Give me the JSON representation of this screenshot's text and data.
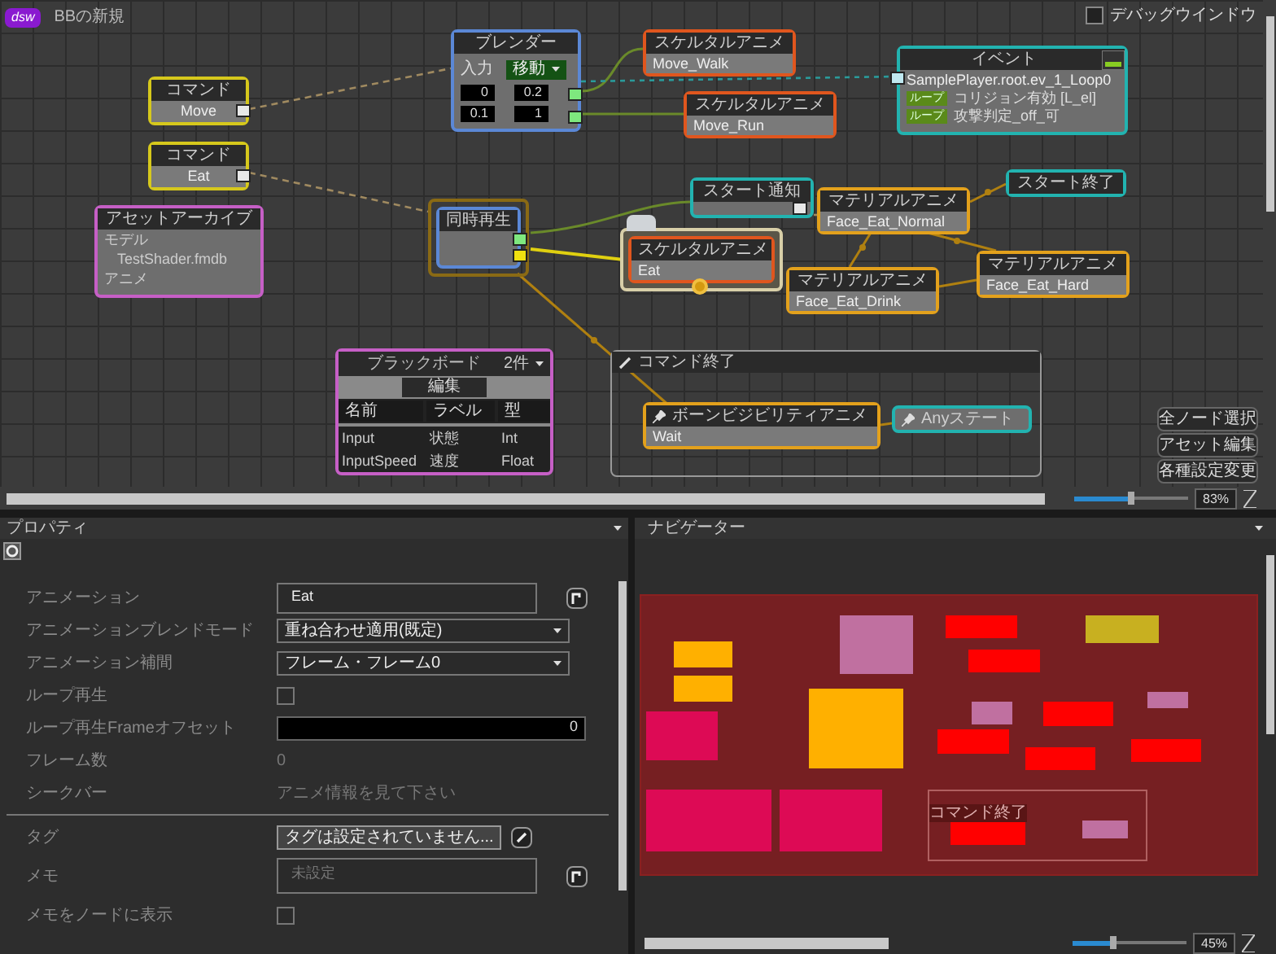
{
  "app": {
    "logo": "dsw",
    "tab_title": "BBの新規"
  },
  "debug_window": {
    "label": "デバッグウインドウ",
    "checked": false
  },
  "nodes": [
    {
      "kind": "command",
      "title": "コマンド",
      "value": "Move",
      "selected": false
    },
    {
      "kind": "command",
      "title": "コマンド",
      "value": "Eat",
      "selected": false
    },
    {
      "kind": "asset",
      "title": "アセットアーカイブ",
      "lines": [
        "モデル",
        "TestShader.fmdb",
        "アニメ"
      ],
      "selected": false
    },
    {
      "kind": "blender",
      "title": "ブレンダー",
      "input_label": "入力",
      "input_value": "移動",
      "values": [
        "0",
        "0.2",
        "0.1",
        "1"
      ],
      "selected": false
    },
    {
      "kind": "skeletal",
      "title": "スケルタルアニメ",
      "value": "Move_Walk",
      "selected": false
    },
    {
      "kind": "skeletal",
      "title": "スケルタルアニメ",
      "value": "Move_Run",
      "selected": false
    },
    {
      "kind": "event",
      "title": "イベント",
      "value": "SamplePlayer.root.ev_1_Loop0",
      "rows": [
        {
          "tag": "ループ",
          "text": "コリジョン有効 [L_el]"
        },
        {
          "tag": "ループ",
          "text": "攻撃判定_off_可"
        }
      ],
      "selected": false
    },
    {
      "kind": "sequence",
      "title": "同時再生",
      "selected": true
    },
    {
      "kind": "notify",
      "title": "スタート通知",
      "selected": false
    },
    {
      "kind": "skeletal",
      "title": "スケルタルアニメ",
      "value": "Eat",
      "selected": true
    },
    {
      "kind": "material",
      "title": "マテリアルアニメ",
      "value": "Face_Eat_Normal",
      "selected": false
    },
    {
      "kind": "state",
      "title": "スタート終了",
      "selected": false
    },
    {
      "kind": "material",
      "title": "マテリアルアニメ",
      "value": "Face_Eat_Drink",
      "selected": false
    },
    {
      "kind": "material",
      "title": "マテリアルアニメ",
      "value": "Face_Eat_Hard",
      "selected": false
    },
    {
      "kind": "bone",
      "title": "ボーンビジビリティアニメ",
      "value": "Wait",
      "selected": false
    },
    {
      "kind": "pinstate",
      "title": "Anyステート",
      "selected": false
    }
  ],
  "group": {
    "title": "コマンド終了"
  },
  "blackboard": {
    "title": "ブラックボード",
    "count": "2件",
    "edit_button": "編集",
    "columns": [
      "名前",
      "ラベル",
      "型"
    ],
    "rows": [
      [
        "Input",
        "状態",
        "Int"
      ],
      [
        "InputSpeed",
        "速度",
        "Float"
      ]
    ]
  },
  "canvas_buttons": [
    "全ノード選択",
    "アセット編集",
    "各種設定変更"
  ],
  "canvas_zoom": {
    "level": 0.5,
    "reading": "83%"
  },
  "properties": {
    "title": "プロパティ",
    "rows": [
      {
        "kind": "text",
        "label": "アニメーション",
        "value": "Eat"
      },
      {
        "kind": "select",
        "label": "アニメーションブレンドモード",
        "value": "重ね合わせ適用(既定)"
      },
      {
        "kind": "select",
        "label": "アニメーション補間",
        "value": "フレーム・フレーム0"
      },
      {
        "kind": "checkbox",
        "label": "ループ再生",
        "checked": false
      },
      {
        "kind": "number",
        "label": "ループ再生Frameオフセット",
        "value": "0"
      },
      {
        "kind": "readonly",
        "label": "フレーム数",
        "value": "0"
      },
      {
        "kind": "readonly",
        "label": "シークバー",
        "value": "アニメ情報を見て下さい"
      }
    ],
    "rows_after_divider": [
      {
        "kind": "tag",
        "label": "タグ",
        "value": "タグは設定されていません..."
      },
      {
        "kind": "memo",
        "label": "メモ",
        "placeholder": "未設定"
      },
      {
        "kind": "checkbox",
        "label": "メモをノードに表示",
        "checked": false
      }
    ]
  },
  "navigator": {
    "title": "ナビゲーター",
    "group_label": "コマンド終了",
    "blocks": [
      {
        "color": "#c070a0"
      },
      {
        "color": "#ff0000"
      },
      {
        "color": "#c8b020"
      },
      {
        "color": "#ff0000"
      },
      {
        "color": "#ffb000"
      },
      {
        "color": "#ffb000"
      },
      {
        "color": "#ffb000"
      },
      {
        "color": "#c070a0"
      },
      {
        "color": "#ff0000"
      },
      {
        "color": "#c070a0"
      },
      {
        "color": "#ff0000"
      },
      {
        "color": "#ff0000"
      },
      {
        "color": "#ff0000"
      },
      {
        "color": "#dd0a55"
      },
      {
        "color": "#dd0a55"
      },
      {
        "color": "#dd0a55"
      },
      {
        "color": "#ff0000"
      },
      {
        "color": "#c070a0"
      }
    ],
    "zoom": {
      "level": 0.35,
      "reading": "45%"
    }
  }
}
